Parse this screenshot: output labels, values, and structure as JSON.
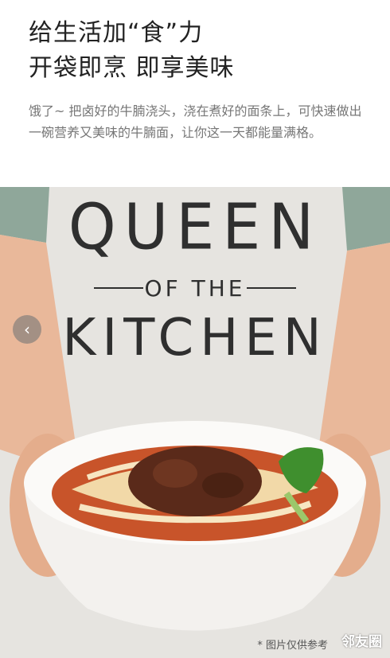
{
  "headline": {
    "line1": "给生活加“食”力",
    "line2": "开袋即烹 即享美味"
  },
  "description": "饿了~ 把卤好的牛腩浇头，浇在煮好的面条上，可快速做出一碗营养又美味的牛腩面，让你这一天都能量满格。",
  "photo": {
    "apron_line1": "QUEEN",
    "apron_line2": "OF THE",
    "apron_line3": "KITCHEN",
    "disclaimer": "* 图片仅供参考",
    "watermark": "邻友圈"
  },
  "carousel": {
    "prev_glyph": "‹"
  },
  "colors": {
    "headline": "#222222",
    "description": "#777777",
    "apron": "#e6e4e0",
    "bowl": "#f3f1ee",
    "broth": "#c8542a",
    "noodles": "#f2d9a8",
    "beef": "#5a2a1a",
    "greens": "#3f8f2e"
  }
}
